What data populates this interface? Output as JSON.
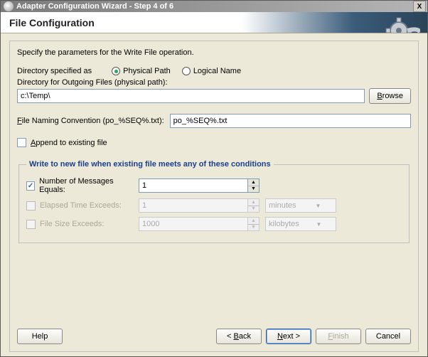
{
  "window": {
    "title": "Adapter Configuration Wizard - Step 4 of 6",
    "close": "X"
  },
  "header": {
    "title": "File Configuration"
  },
  "instruction": "Specify the parameters for the Write File operation.",
  "dirSpec": {
    "label": "Directory specified as",
    "physical": "Physical Path",
    "logical": "Logical Name",
    "selected": "physical"
  },
  "outgoing": {
    "label": "Directory for Outgoing Files (physical path):",
    "value": "c:\\Temp\\",
    "browse": "Browse"
  },
  "naming": {
    "label": "File Naming Convention (po_%SEQ%.txt):",
    "value": "po_%SEQ%.txt"
  },
  "append": {
    "label": "Append to existing file",
    "checked": false
  },
  "conditions": {
    "legend": "Write to new file when existing file meets any of these conditions",
    "rows": [
      {
        "label": "Number of Messages Equals:",
        "value": "1",
        "checked": true,
        "unit": "",
        "enabled": true
      },
      {
        "label": "Elapsed Time Exceeds:",
        "value": "1",
        "checked": false,
        "unit": "minutes",
        "enabled": false
      },
      {
        "label": "File Size Exceeds:",
        "value": "1000",
        "checked": false,
        "unit": "kilobytes",
        "enabled": false
      }
    ]
  },
  "buttons": {
    "help": "Help",
    "back": "< Back",
    "next": "Next >",
    "finish": "Finish",
    "cancel": "Cancel"
  }
}
